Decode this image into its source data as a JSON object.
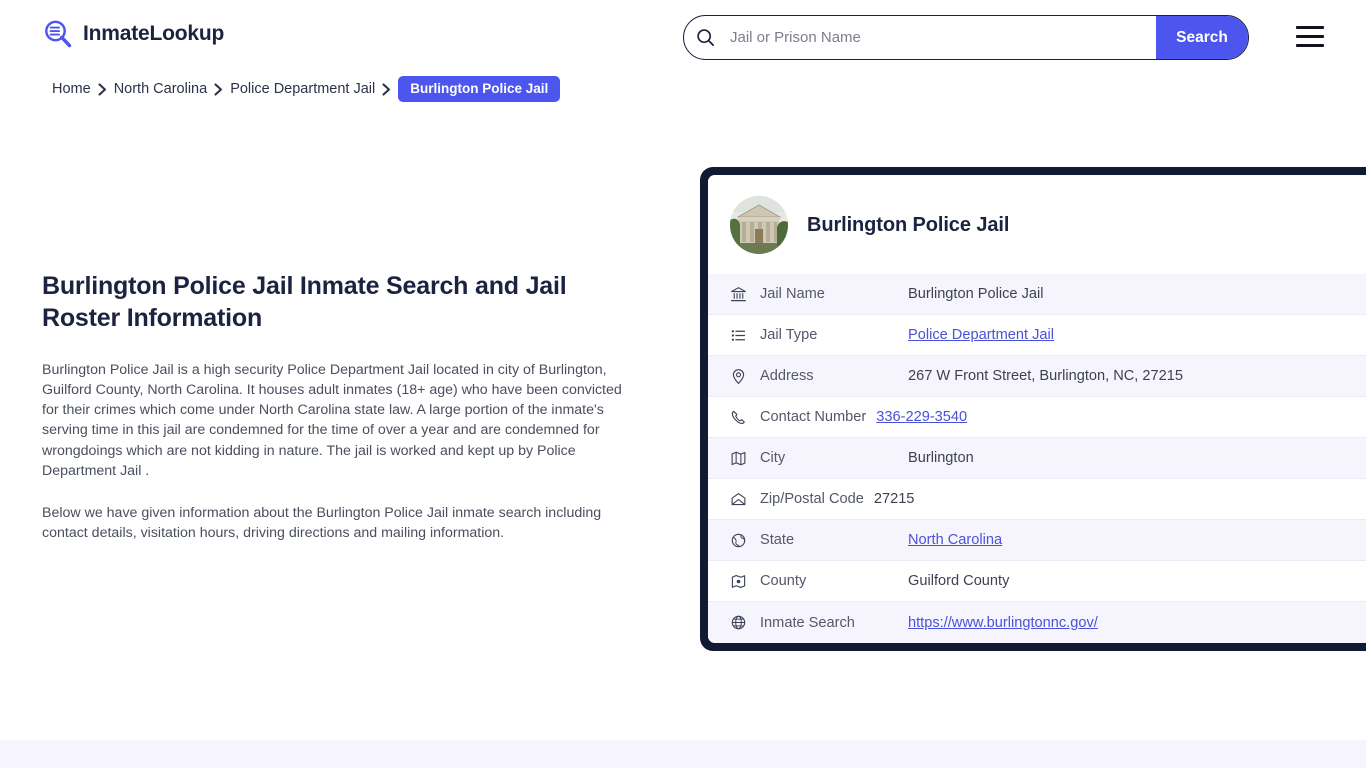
{
  "header": {
    "brand_name": "InmateLookup",
    "brand_icon": "magnifier-list-icon",
    "search": {
      "placeholder": "Jail or Prison Name",
      "value": "",
      "button_label": "Search",
      "icon": "search-icon"
    },
    "menu_icon": "hamburger-menu-icon"
  },
  "breadcrumb": {
    "items": [
      {
        "label": "Home",
        "current": false
      },
      {
        "label": "North Carolina",
        "current": false
      },
      {
        "label": "Police Department Jail",
        "current": false
      },
      {
        "label": "Burlington Police Jail",
        "current": true
      }
    ],
    "separator": "›"
  },
  "main": {
    "title": "Burlington Police Jail Inmate Search and Jail Roster Information",
    "paragraphs": [
      "Burlington Police Jail is a high security Police Department Jail located in city of Burlington, Guilford County, North Carolina. It houses adult inmates (18+ age) who have been convicted for their crimes which come under North Carolina state law. A large portion of the inmate's serving time in this jail are condemned for the time of over a year and are condemned for wrongdoings which are not kidding in nature. The jail is worked and kept up by Police Department Jail .",
      "Below we have given information about the Burlington Police Jail inmate search including contact details, visitation hours, driving directions and mailing information."
    ]
  },
  "card": {
    "title": "Burlington Police Jail",
    "avatar_icon": "courthouse-building-photo",
    "rows": [
      {
        "icon": "bank-icon",
        "label": "Jail Name",
        "value": "Burlington Police Jail",
        "is_link": false
      },
      {
        "icon": "list-icon",
        "label": "Jail Type",
        "value": "Police Department Jail",
        "is_link": true
      },
      {
        "icon": "map-pin-icon",
        "label": "Address",
        "value": "267 W Front Street, Burlington, NC, 27215",
        "is_link": false
      },
      {
        "icon": "phone-icon",
        "label": "Contact Number",
        "value": "336-229-3540",
        "is_link": true
      },
      {
        "icon": "map-icon",
        "label": "City",
        "value": "Burlington",
        "is_link": false
      },
      {
        "icon": "envelope-icon",
        "label": "Zip/Postal Code",
        "value": "27215",
        "is_link": false
      },
      {
        "icon": "globe-pin-icon",
        "label": "State",
        "value": "North Carolina",
        "is_link": true
      },
      {
        "icon": "county-map-icon",
        "label": "County",
        "value": "Guilford County",
        "is_link": false
      },
      {
        "icon": "globe-icon",
        "label": "Inmate Search",
        "value": "https://www.burlingtonnc.gov/",
        "is_link": true
      }
    ]
  },
  "colors": {
    "accent": "#4c55ed",
    "dark": "#111a33",
    "link": "#4a52d8",
    "row_alt": "#f6f5fd",
    "footer_band": "#f5f4ff"
  }
}
